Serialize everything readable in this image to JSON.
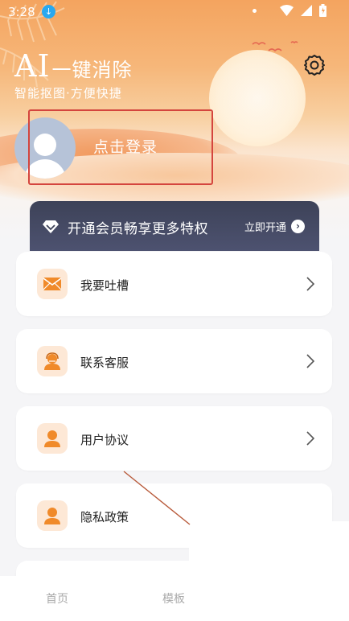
{
  "status_bar": {
    "time": "3:28",
    "icons": [
      "download-icon",
      "dot-icon",
      "wifi-icon",
      "signal-icon",
      "battery-icon"
    ]
  },
  "header": {
    "title_main": "AI",
    "title_sub": "一键消除",
    "subtitle": "智能抠图·方便快捷",
    "settings_icon": "gear-icon"
  },
  "profile": {
    "login_label": "点击登录",
    "avatar_icon": "user-avatar-icon"
  },
  "vip_banner": {
    "text": "开通会员畅享更多特权",
    "action_label": "立即开通"
  },
  "menu": {
    "items": [
      {
        "label": "我要吐槽",
        "icon": "mail-icon"
      },
      {
        "label": "联系客服",
        "icon": "customer-service-icon"
      },
      {
        "label": "用户协议",
        "icon": "user-icon"
      },
      {
        "label": "隐私政策",
        "icon": "user-icon"
      }
    ]
  },
  "tab_bar": {
    "items": [
      {
        "label": "首页"
      },
      {
        "label": "模板"
      }
    ]
  },
  "colors": {
    "header_orange": "#f4a45f",
    "vip_dark": "#3d4258",
    "icon_orange": "#f08a2a",
    "icon_bg": "#fde8d6",
    "highlight_red": "#d4453e"
  }
}
